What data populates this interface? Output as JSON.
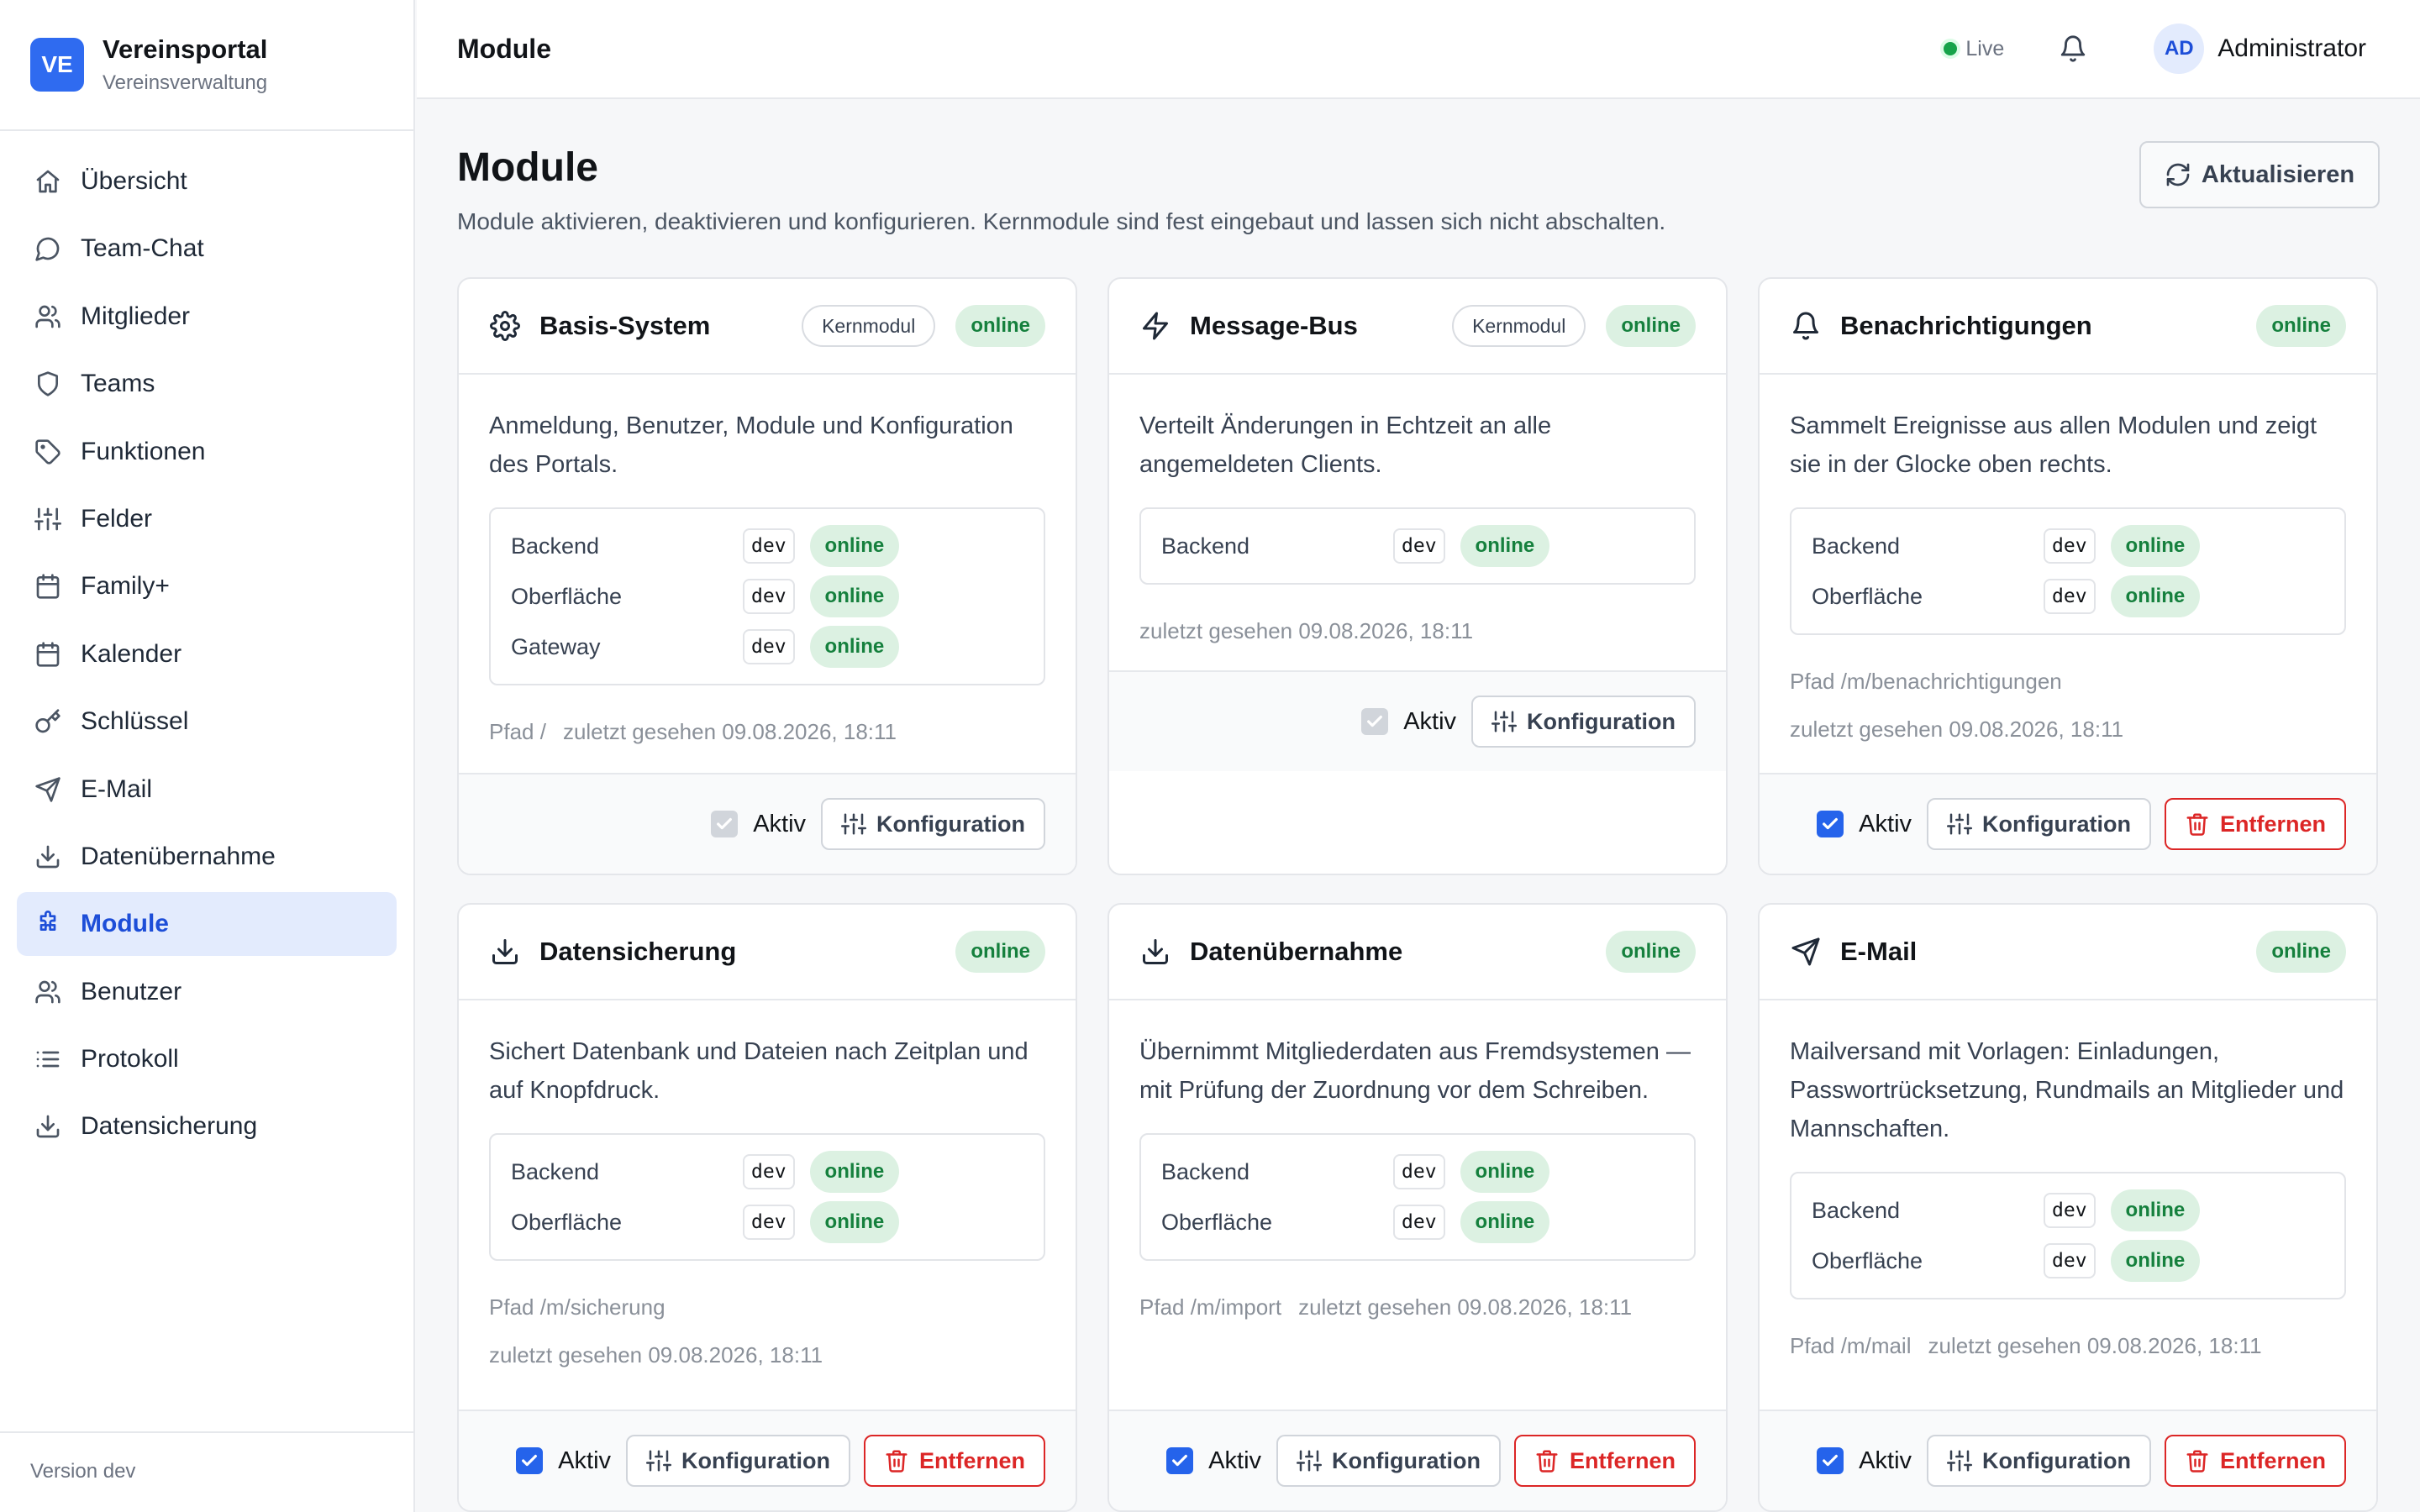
{
  "brand": {
    "logo": "VE",
    "title": "Vereinsportal",
    "subtitle": "Vereinsverwaltung"
  },
  "sidebar": {
    "items": [
      {
        "label": "Übersicht",
        "icon": "home-icon",
        "active": false
      },
      {
        "label": "Team-Chat",
        "icon": "chat-icon",
        "active": false
      },
      {
        "label": "Mitglieder",
        "icon": "users-icon",
        "active": false
      },
      {
        "label": "Teams",
        "icon": "shield-icon",
        "active": false
      },
      {
        "label": "Funktionen",
        "icon": "tag-icon",
        "active": false
      },
      {
        "label": "Felder",
        "icon": "sliders-icon",
        "active": false
      },
      {
        "label": "Family+",
        "icon": "calendar-icon",
        "active": false
      },
      {
        "label": "Kalender",
        "icon": "calendar-icon",
        "active": false
      },
      {
        "label": "Schlüssel",
        "icon": "key-icon",
        "active": false
      },
      {
        "label": "E-Mail",
        "icon": "send-icon",
        "active": false
      },
      {
        "label": "Datenübernahme",
        "icon": "download-icon",
        "active": false
      },
      {
        "label": "Module",
        "icon": "puzzle-icon",
        "active": true
      },
      {
        "label": "Benutzer",
        "icon": "users-icon",
        "active": false
      },
      {
        "label": "Protokoll",
        "icon": "list-icon",
        "active": false
      },
      {
        "label": "Datensicherung",
        "icon": "download-icon",
        "active": false
      }
    ],
    "version": "Version dev"
  },
  "header": {
    "title": "Module",
    "live": "Live",
    "avatar": "AD",
    "user": "Administrator"
  },
  "main": {
    "title": "Module",
    "description": "Module aktivieren, deaktivieren und konfigurieren. Kernmodule sind fest eingebaut und lassen sich nicht abschalten.",
    "refresh_label": "Aktualisieren"
  },
  "labels": {
    "aktiv": "Aktiv",
    "konfiguration": "Konfiguration",
    "entfernen": "Entfernen",
    "online": "online",
    "kernmodul": "Kernmodul"
  },
  "modules": [
    {
      "title": "Basis-System",
      "icon": "gear-icon",
      "core": true,
      "status": "online",
      "description": "Anmeldung, Benutzer, Module und Konfiguration des Portals.",
      "components": [
        {
          "name": "Backend",
          "env": "dev",
          "status": "online"
        },
        {
          "name": "Oberfläche",
          "env": "dev",
          "status": "online"
        },
        {
          "name": "Gateway",
          "env": "dev",
          "status": "online"
        }
      ],
      "meta_lines": [
        [
          "Pfad /",
          "zuletzt gesehen 09.08.2026, 18:11"
        ]
      ],
      "active": true,
      "locked": true,
      "removable": false
    },
    {
      "title": "Message-Bus",
      "icon": "lightning-icon",
      "core": true,
      "status": "online",
      "description": "Verteilt Änderungen in Echtzeit an alle angemeldeten Clients.",
      "components": [
        {
          "name": "Backend",
          "env": "dev",
          "status": "online"
        }
      ],
      "meta_lines": [
        [
          "zuletzt gesehen 09.08.2026, 18:11"
        ]
      ],
      "active": true,
      "locked": true,
      "removable": false
    },
    {
      "title": "Benachrichtigungen",
      "icon": "bell-icon",
      "core": false,
      "status": "online",
      "description": "Sammelt Ereignisse aus allen Modulen und zeigt sie in der Glocke oben rechts.",
      "components": [
        {
          "name": "Backend",
          "env": "dev",
          "status": "online"
        },
        {
          "name": "Oberfläche",
          "env": "dev",
          "status": "online"
        }
      ],
      "meta_lines": [
        [
          "Pfad /m/benachrichtigungen"
        ],
        [
          "zuletzt gesehen 09.08.2026, 18:11"
        ]
      ],
      "active": true,
      "locked": false,
      "removable": true
    },
    {
      "title": "Datensicherung",
      "icon": "download-icon",
      "core": false,
      "status": "online",
      "description": "Sichert Datenbank und Dateien nach Zeitplan und auf Knopfdruck.",
      "components": [
        {
          "name": "Backend",
          "env": "dev",
          "status": "online"
        },
        {
          "name": "Oberfläche",
          "env": "dev",
          "status": "online"
        }
      ],
      "meta_lines": [
        [
          "Pfad /m/sicherung"
        ],
        [
          "zuletzt gesehen 09.08.2026, 18:11"
        ]
      ],
      "active": true,
      "locked": false,
      "removable": true
    },
    {
      "title": "Datenübernahme",
      "icon": "download-icon",
      "core": false,
      "status": "online",
      "description": "Übernimmt Mitgliederdaten aus Fremdsystemen — mit Prüfung der Zuordnung vor dem Schreiben.",
      "components": [
        {
          "name": "Backend",
          "env": "dev",
          "status": "online"
        },
        {
          "name": "Oberfläche",
          "env": "dev",
          "status": "online"
        }
      ],
      "meta_lines": [
        [
          "Pfad /m/import",
          "zuletzt gesehen 09.08.2026, 18:11"
        ]
      ],
      "active": true,
      "locked": false,
      "removable": true
    },
    {
      "title": "E-Mail",
      "icon": "send-icon",
      "core": false,
      "status": "online",
      "description": "Mailversand mit Vorlagen: Einladungen, Passwortrücksetzung, Rundmails an Mitglieder und Mannschaften.",
      "components": [
        {
          "name": "Backend",
          "env": "dev",
          "status": "online"
        },
        {
          "name": "Oberfläche",
          "env": "dev",
          "status": "online"
        }
      ],
      "meta_lines": [
        [
          "Pfad /m/mail",
          "zuletzt gesehen 09.08.2026, 18:11"
        ]
      ],
      "active": true,
      "locked": false,
      "removable": true
    }
  ]
}
